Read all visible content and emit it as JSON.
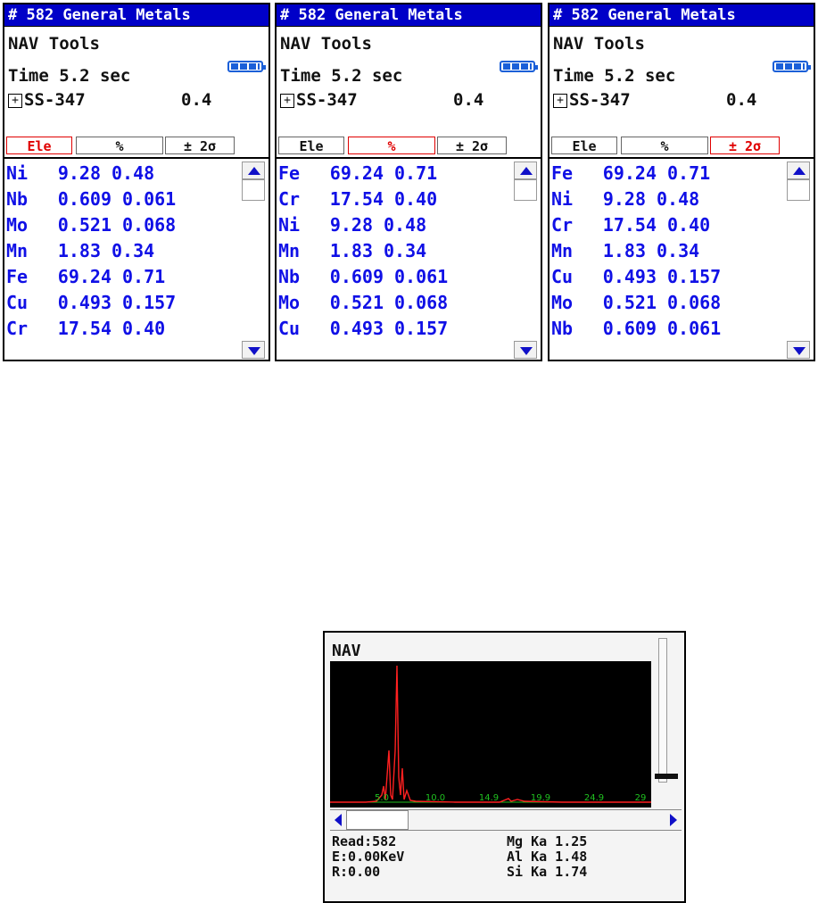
{
  "panels": [
    {
      "title": "# 582 General Metals",
      "menu": "NAV Tools",
      "time": "Time 5.2 sec",
      "alloy": {
        "expander": "+",
        "name": "SS-347",
        "value": "0.4"
      },
      "tabs": [
        "Ele",
        "%",
        "± 2σ"
      ],
      "active_tab": "Ele",
      "rows": [
        {
          "el": "Ni",
          "pct": "9.28",
          "sig": "0.48"
        },
        {
          "el": "Nb",
          "pct": "0.609",
          "sig": "0.061"
        },
        {
          "el": "Mo",
          "pct": "0.521",
          "sig": "0.068"
        },
        {
          "el": "Mn",
          "pct": "1.83",
          "sig": "0.34"
        },
        {
          "el": "Fe",
          "pct": "69.24",
          "sig": "0.71"
        },
        {
          "el": "Cu",
          "pct": "0.493",
          "sig": "0.157"
        },
        {
          "el": "Cr",
          "pct": "17.54",
          "sig": "0.40"
        }
      ]
    },
    {
      "title": "# 582 General Metals",
      "menu": "NAV Tools",
      "time": "Time 5.2 sec",
      "alloy": {
        "expander": "+",
        "name": "SS-347",
        "value": "0.4"
      },
      "tabs": [
        "Ele",
        "%",
        "± 2σ"
      ],
      "active_tab": "%",
      "rows": [
        {
          "el": "Fe",
          "pct": "69.24",
          "sig": "0.71"
        },
        {
          "el": "Cr",
          "pct": "17.54",
          "sig": "0.40"
        },
        {
          "el": "Ni",
          "pct": "9.28",
          "sig": "0.48"
        },
        {
          "el": "Mn",
          "pct": "1.83",
          "sig": "0.34"
        },
        {
          "el": "Nb",
          "pct": "0.609",
          "sig": "0.061"
        },
        {
          "el": "Mo",
          "pct": "0.521",
          "sig": "0.068"
        },
        {
          "el": "Cu",
          "pct": "0.493",
          "sig": "0.157"
        }
      ]
    },
    {
      "title": "# 582 General Metals",
      "menu": "NAV Tools",
      "time": "Time 5.2 sec",
      "alloy": {
        "expander": "+",
        "name": "SS-347",
        "value": "0.4"
      },
      "tabs": [
        "Ele",
        "%",
        "± 2σ"
      ],
      "active_tab": "± 2σ",
      "rows": [
        {
          "el": "Fe",
          "pct": "69.24",
          "sig": "0.71"
        },
        {
          "el": "Ni",
          "pct": "9.28",
          "sig": "0.48"
        },
        {
          "el": "Cr",
          "pct": "17.54",
          "sig": "0.40"
        },
        {
          "el": "Mn",
          "pct": "1.83",
          "sig": "0.34"
        },
        {
          "el": "Cu",
          "pct": "0.493",
          "sig": "0.157"
        },
        {
          "el": "Mo",
          "pct": "0.521",
          "sig": "0.068"
        },
        {
          "el": "Nb",
          "pct": "0.609",
          "sig": "0.061"
        }
      ]
    }
  ],
  "spectrum_screen": {
    "title": "NAV",
    "axis_ticks": [
      "5.0",
      "10.0",
      "14.9",
      "19.9",
      "24.9",
      "29"
    ],
    "readout_left": [
      "Read:582",
      "E:0.00KeV",
      "R:0.00"
    ],
    "readout_right": [
      "Mg Ka 1.25",
      "Al Ka 1.48",
      "Si Ka 1.74"
    ],
    "colors": {
      "spectrum": "#ff2020",
      "axis": "#20c020",
      "title_bar": "#0000c8",
      "values": "#1010e6",
      "active_tab": "#e00000"
    },
    "icons": [
      "battery-icon",
      "scroll-up-arrow-icon",
      "scroll-down-arrow-icon",
      "scroll-left-arrow-icon",
      "scroll-right-arrow-icon",
      "expand-plus-icon"
    ]
  }
}
